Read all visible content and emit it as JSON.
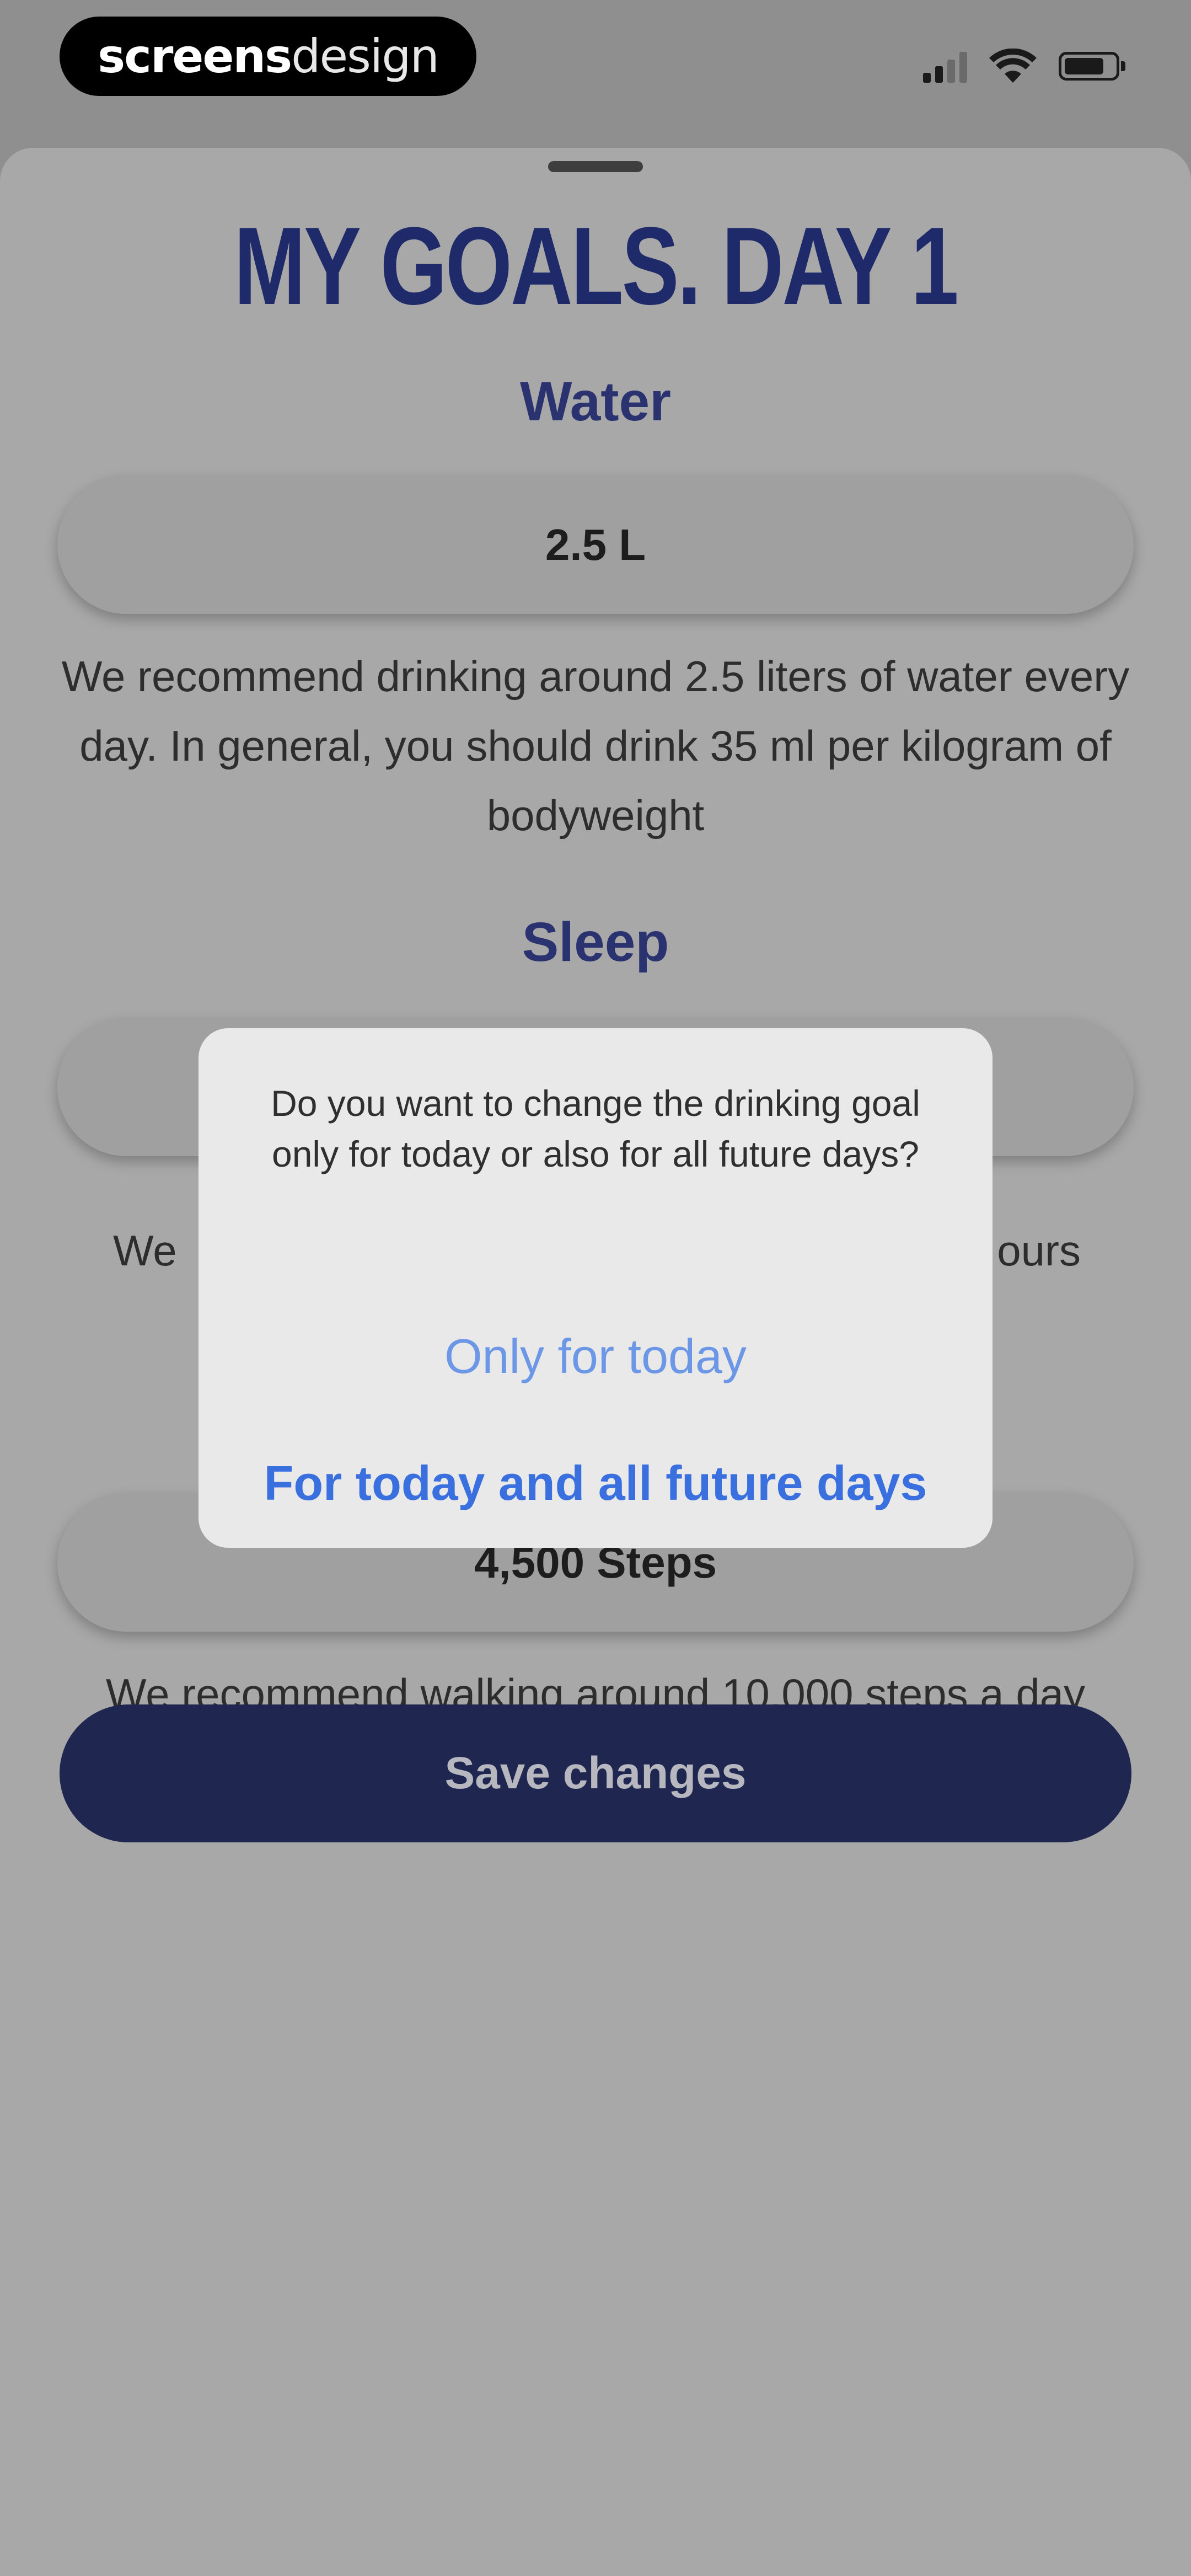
{
  "status_bar": {
    "brand_bold": "screens",
    "brand_light": "design",
    "icons": [
      "signal-icon",
      "wifi-icon",
      "battery-icon"
    ]
  },
  "sheet": {
    "title": "MY GOALS. DAY 1",
    "water": {
      "heading": "Water",
      "value": "2.5 L",
      "description": "We recommend drinking around 2.5 liters of water every day. In general, you should drink 35 ml per kilogram of bodyweight"
    },
    "sleep": {
      "heading": "Sleep",
      "description_start": "We",
      "description_end": "ours"
    },
    "steps": {
      "value": "4,500 Steps",
      "description": "We recommend walking around 10,000 steps a day"
    },
    "save_label": "Save changes"
  },
  "dialog": {
    "message": "Do you want to change the drinking goal only for today or also for all future days?",
    "option_today": "Only for today",
    "option_all": "For today and all future days"
  },
  "colors": {
    "title": "#1e2a6a",
    "save_button": "#1f2750",
    "dialog_action": "#3a6fe0"
  }
}
